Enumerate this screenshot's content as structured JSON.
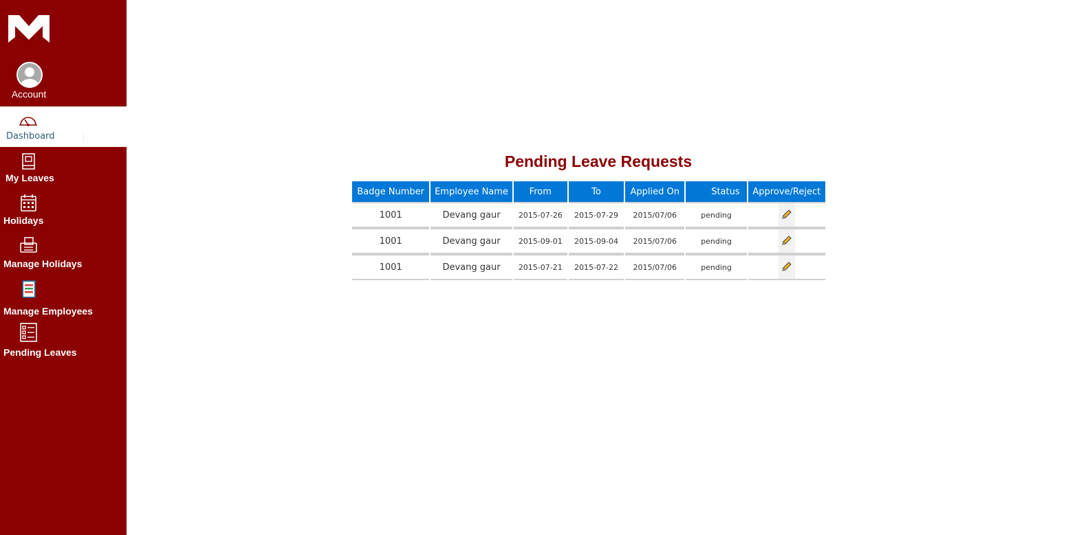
{
  "sidebar": {
    "account_label": "Account",
    "dashboard_label": "Dashboard",
    "items": [
      {
        "label": "My Leaves",
        "icon": "book-icon"
      },
      {
        "label": "Holidays",
        "icon": "calendar-icon"
      },
      {
        "label": "Manage Holidays",
        "icon": "printer-icon"
      },
      {
        "label": "Manage Employees",
        "icon": "clipboard-icon"
      },
      {
        "label": "Pending Leaves",
        "icon": "checklist-icon"
      }
    ]
  },
  "main": {
    "title": "Pending Leave Requests",
    "columns": [
      "Badge Number",
      "Employee Name",
      "From",
      "To",
      "Applied On",
      "Status",
      "Approve/Reject"
    ],
    "rows": [
      {
        "badge": "1001",
        "name": "Devang gaur",
        "from": "2015-07-26",
        "to": "2015-07-29",
        "applied": "2015/07/06",
        "status": "pending"
      },
      {
        "badge": "1001",
        "name": "Devang gaur",
        "from": "2015-09-01",
        "to": "2015-09-04",
        "applied": "2015/07/06",
        "status": "pending"
      },
      {
        "badge": "1001",
        "name": "Devang gaur",
        "from": "2015-07-21",
        "to": "2015-07-22",
        "applied": "2015/07/06",
        "status": "pending"
      }
    ]
  },
  "colors": {
    "sidebar_bg": "#8b0000",
    "title": "#8b0000",
    "table_header": "#0078d7"
  }
}
